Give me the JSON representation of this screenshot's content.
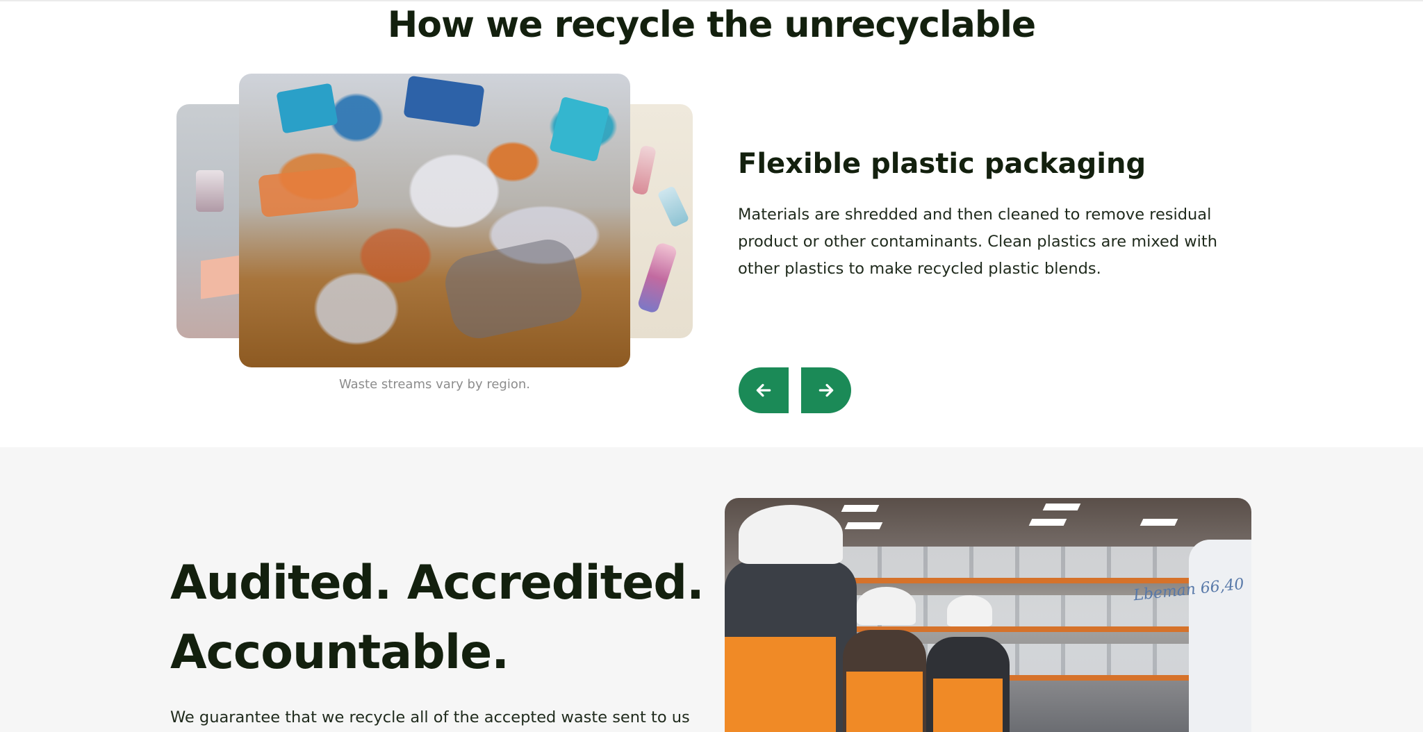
{
  "recycle_section": {
    "title": "How we recycle the unrecyclable",
    "slide": {
      "heading": "Flexible plastic packaging",
      "description": "Materials are shredded and then cleaned to remove residual product or other contaminants. Clean plastics are mixed with other plastics to make recycled plastic blends.",
      "caption": "Waste streams vary by region."
    },
    "nav": {
      "prev_icon": "arrow-left-icon",
      "next_icon": "arrow-right-icon"
    }
  },
  "audit_section": {
    "title_line1": "Audited. Accredited.",
    "title_line2": "Accountable.",
    "body": "We guarantee that we recycle all of the accepted waste sent to us",
    "photo_label": "Lbeman 66,40"
  },
  "colors": {
    "accent_green": "#1b8a57",
    "heading_dark": "#13200e",
    "section_bg": "#f6f6f6",
    "caption_gray": "#8c8c8c"
  }
}
